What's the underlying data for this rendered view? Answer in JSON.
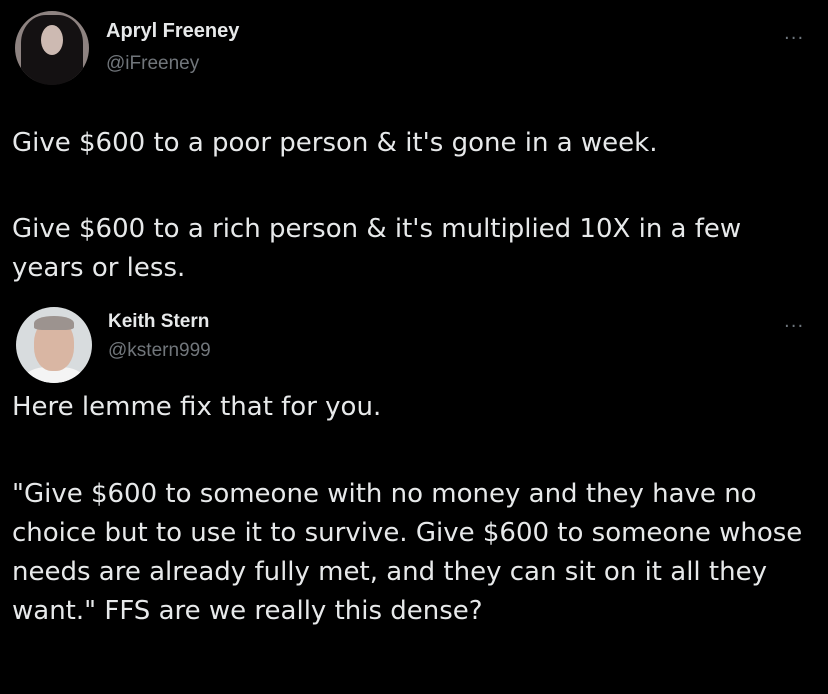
{
  "tweets": [
    {
      "name": "Apryl Freeney",
      "handle": "@iFreeney",
      "more_label": "...",
      "paragraphs": [
        "Give $600 to a poor person & it's gone in a week.",
        "Give $600 to a rich person & it's multiplied 10X in a few years or less."
      ]
    },
    {
      "name": "Keith Stern",
      "handle": "@kstern999",
      "more_label": "...",
      "paragraphs": [
        "Here lemme fix that for you.",
        "\"Give $600 to someone with no money and they have no choice but to use it to survive. Give $600 to someone whose needs are already fully met, and they can sit on it all they want.\" FFS are we really this dense?"
      ]
    }
  ],
  "colors": {
    "background": "#000000",
    "text": "#e7e9ea",
    "secondary_text": "#71767b"
  },
  "icons": [
    "avatar",
    "more-options-icon"
  ]
}
